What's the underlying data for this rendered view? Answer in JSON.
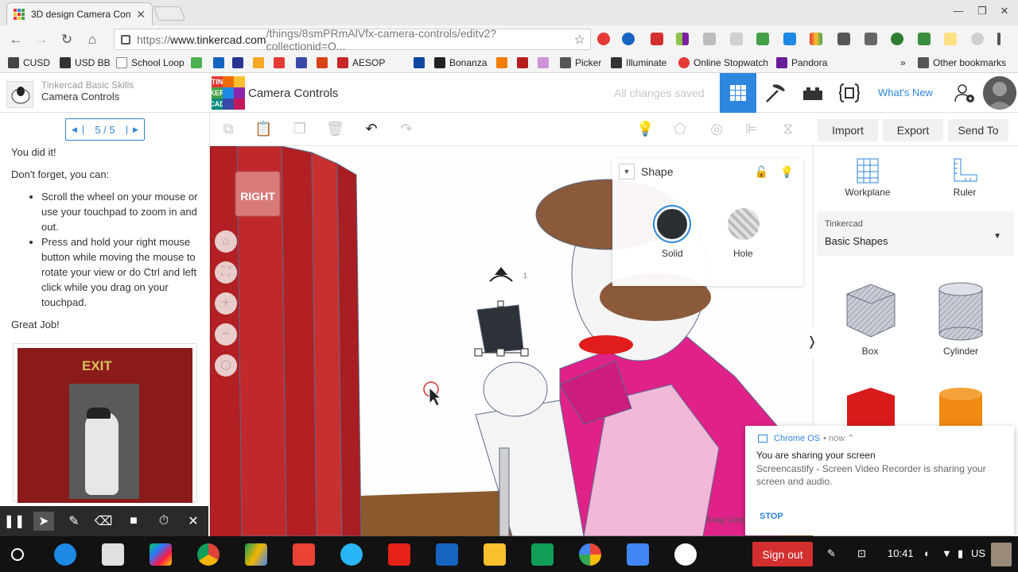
{
  "browser": {
    "tab_title": "3D design Camera Controls",
    "url_prefix": "https://",
    "url_host": "www.tinkercad.com",
    "url_path": "/things/8smPRmAlVfx-camera-controls/editv2?collectionid=O...",
    "window_minimize": "—",
    "window_restore": "❐",
    "window_close": "✕",
    "tab_close": "✕"
  },
  "bookmarks": [
    {
      "label": "CUSD",
      "color": "#444444"
    },
    {
      "label": "USD BB",
      "color": "#333333"
    },
    {
      "label": "School Loop",
      "color": "#888888"
    },
    {
      "label": "",
      "color": "#4caf50"
    },
    {
      "label": "",
      "color": "#1565c0"
    },
    {
      "label": "",
      "color": "#283593"
    },
    {
      "label": "",
      "color": "#f9a825"
    },
    {
      "label": "",
      "color": "#e53935"
    },
    {
      "label": "",
      "color": "#3949ab"
    },
    {
      "label": "",
      "color": "#d84315"
    },
    {
      "label": "AESOP",
      "color": "#c62828"
    },
    {
      "label": "",
      "color": "#0d47a1"
    },
    {
      "label": "Bonanza",
      "color": "#222222"
    },
    {
      "label": "",
      "color": "#f57c00"
    },
    {
      "label": "",
      "color": "#b71c1c"
    },
    {
      "label": "",
      "color": "#ce93d8"
    },
    {
      "label": "Picker",
      "color": "#555555"
    },
    {
      "label": "Illuminate",
      "color": "#333333"
    },
    {
      "label": "Online Stopwatch",
      "color": "#e53935"
    },
    {
      "label": "Pandora",
      "color": "#6a1b9a"
    }
  ],
  "bookmarks_more": "»",
  "other_bookmarks": "Other bookmarks",
  "lesson": {
    "category": "Tinkercad Basic Skills",
    "name": "Camera Controls",
    "page": "5 / 5",
    "p1": "You did it!",
    "p2": "Don't forget, you can:",
    "bullets": [
      "Scroll the wheel on your mouse or use your touchpad to zoom in and out.",
      "Press and hold your right mouse button while moving the mouse to rotate your view or do Ctrl and left click while you drag on your touchpad."
    ],
    "p3": "Great Job!",
    "image_sign": "EXIT"
  },
  "header": {
    "logo_letters": [
      "TIN",
      "KER",
      "CAD"
    ],
    "project_name": "Camera Controls",
    "save_status": "All changes saved",
    "whats_new": "What's New"
  },
  "toolbar": {
    "import": "Import",
    "export": "Export",
    "send_to": "Send To"
  },
  "viewport": {
    "right_label": "RIGHT",
    "snap_grid": "Snap Grid",
    "height_tick": "1"
  },
  "shape_panel": {
    "title": "Shape",
    "solid": "Solid",
    "hole": "Hole"
  },
  "right_panel": {
    "workplane": "Workplane",
    "ruler": "Ruler",
    "library_category": "Tinkercad",
    "library_name": "Basic Shapes",
    "shapes": [
      "Box",
      "Cylinder"
    ]
  },
  "notification": {
    "source": "Chrome OS",
    "time": "• now ⌃",
    "title": "You are sharing your screen",
    "body": "Screencastify - Screen Video Recorder is sharing your screen and audio.",
    "action": "STOP"
  },
  "shelf": {
    "sign_out": "Sign out",
    "time": "10:41",
    "locale": "US"
  },
  "colors": {
    "accent": "#2e86de",
    "curtain": "#b22024",
    "shirt": "#e0218a",
    "sign_out": "#d32f2f"
  }
}
